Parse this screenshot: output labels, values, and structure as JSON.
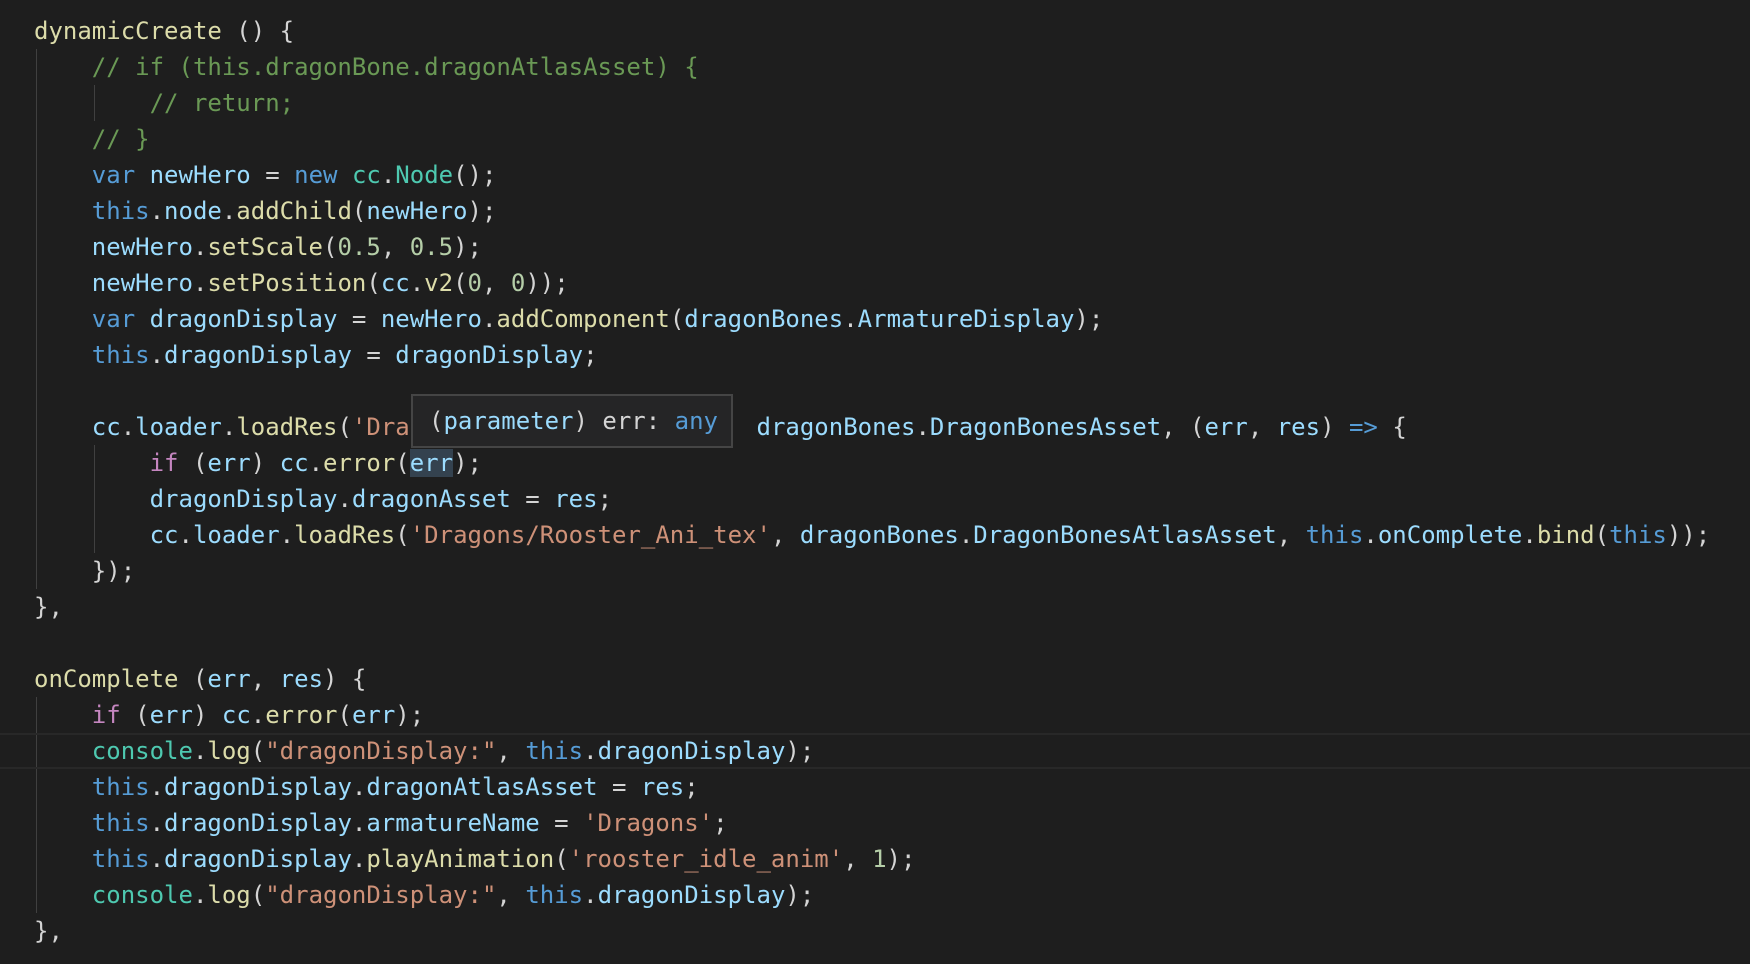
{
  "editor": {
    "language": "javascript",
    "lines": [
      [
        {
          "c": "fn",
          "t": "dynamicCreate"
        },
        {
          "c": "pl",
          "t": " () {"
        }
      ],
      [
        {
          "c": "cm",
          "t": "    // if (this.dragonBone.dragonAtlasAsset) {"
        }
      ],
      [
        {
          "c": "cm",
          "t": "        // return;"
        }
      ],
      [
        {
          "c": "cm",
          "t": "    // }"
        }
      ],
      [
        {
          "c": "pl",
          "t": "    "
        },
        {
          "c": "kw",
          "t": "var"
        },
        {
          "c": "pl",
          "t": " "
        },
        {
          "c": "var",
          "t": "newHero"
        },
        {
          "c": "pl",
          "t": " = "
        },
        {
          "c": "kw",
          "t": "new"
        },
        {
          "c": "pl",
          "t": " "
        },
        {
          "c": "cls",
          "t": "cc"
        },
        {
          "c": "pl",
          "t": "."
        },
        {
          "c": "cls",
          "t": "Node"
        },
        {
          "c": "pl",
          "t": "();"
        }
      ],
      [
        {
          "c": "pl",
          "t": "    "
        },
        {
          "c": "kw",
          "t": "this"
        },
        {
          "c": "pl",
          "t": "."
        },
        {
          "c": "var",
          "t": "node"
        },
        {
          "c": "pl",
          "t": "."
        },
        {
          "c": "fn",
          "t": "addChild"
        },
        {
          "c": "pl",
          "t": "("
        },
        {
          "c": "var",
          "t": "newHero"
        },
        {
          "c": "pl",
          "t": ");"
        }
      ],
      [
        {
          "c": "pl",
          "t": "    "
        },
        {
          "c": "var",
          "t": "newHero"
        },
        {
          "c": "pl",
          "t": "."
        },
        {
          "c": "fn",
          "t": "setScale"
        },
        {
          "c": "pl",
          "t": "("
        },
        {
          "c": "num",
          "t": "0.5"
        },
        {
          "c": "pl",
          "t": ", "
        },
        {
          "c": "num",
          "t": "0.5"
        },
        {
          "c": "pl",
          "t": ");"
        }
      ],
      [
        {
          "c": "pl",
          "t": "    "
        },
        {
          "c": "var",
          "t": "newHero"
        },
        {
          "c": "pl",
          "t": "."
        },
        {
          "c": "fn",
          "t": "setPosition"
        },
        {
          "c": "pl",
          "t": "("
        },
        {
          "c": "var",
          "t": "cc"
        },
        {
          "c": "pl",
          "t": "."
        },
        {
          "c": "fn",
          "t": "v2"
        },
        {
          "c": "pl",
          "t": "("
        },
        {
          "c": "num",
          "t": "0"
        },
        {
          "c": "pl",
          "t": ", "
        },
        {
          "c": "num",
          "t": "0"
        },
        {
          "c": "pl",
          "t": "));"
        }
      ],
      [
        {
          "c": "pl",
          "t": "    "
        },
        {
          "c": "kw",
          "t": "var"
        },
        {
          "c": "pl",
          "t": " "
        },
        {
          "c": "var",
          "t": "dragonDisplay"
        },
        {
          "c": "pl",
          "t": " = "
        },
        {
          "c": "var",
          "t": "newHero"
        },
        {
          "c": "pl",
          "t": "."
        },
        {
          "c": "fn",
          "t": "addComponent"
        },
        {
          "c": "pl",
          "t": "("
        },
        {
          "c": "var",
          "t": "dragonBones"
        },
        {
          "c": "pl",
          "t": "."
        },
        {
          "c": "var",
          "t": "ArmatureDisplay"
        },
        {
          "c": "pl",
          "t": ");"
        }
      ],
      [
        {
          "c": "pl",
          "t": "    "
        },
        {
          "c": "kw",
          "t": "this"
        },
        {
          "c": "pl",
          "t": "."
        },
        {
          "c": "var",
          "t": "dragonDisplay"
        },
        {
          "c": "pl",
          "t": " = "
        },
        {
          "c": "var",
          "t": "dragonDisplay"
        },
        {
          "c": "pl",
          "t": ";"
        }
      ],
      [],
      [
        {
          "c": "pl",
          "t": "    "
        },
        {
          "c": "var",
          "t": "cc"
        },
        {
          "c": "pl",
          "t": "."
        },
        {
          "c": "var",
          "t": "loader"
        },
        {
          "c": "pl",
          "t": "."
        },
        {
          "c": "fn",
          "t": "loadRes"
        },
        {
          "c": "pl",
          "t": "("
        },
        {
          "c": "str",
          "t": "'Dra"
        },
        {
          "c": "pl",
          "t": "                        "
        },
        {
          "c": "var",
          "t": "dragonBones"
        },
        {
          "c": "pl",
          "t": "."
        },
        {
          "c": "var",
          "t": "DragonBonesAsset"
        },
        {
          "c": "pl",
          "t": ", ("
        },
        {
          "c": "var",
          "t": "err"
        },
        {
          "c": "pl",
          "t": ", "
        },
        {
          "c": "var",
          "t": "res"
        },
        {
          "c": "pl",
          "t": ") "
        },
        {
          "c": "kw",
          "t": "=>"
        },
        {
          "c": "pl",
          "t": " {"
        }
      ],
      [
        {
          "c": "pl",
          "t": "        "
        },
        {
          "c": "ctl",
          "t": "if"
        },
        {
          "c": "pl",
          "t": " ("
        },
        {
          "c": "var",
          "t": "err"
        },
        {
          "c": "pl",
          "t": ") "
        },
        {
          "c": "var",
          "t": "cc"
        },
        {
          "c": "pl",
          "t": "."
        },
        {
          "c": "fn",
          "t": "error"
        },
        {
          "c": "pl",
          "t": "("
        },
        {
          "c": "var hl",
          "t": "err"
        },
        {
          "c": "pl",
          "t": ");"
        }
      ],
      [
        {
          "c": "pl",
          "t": "        "
        },
        {
          "c": "var",
          "t": "dragonDisplay"
        },
        {
          "c": "pl",
          "t": "."
        },
        {
          "c": "var",
          "t": "dragonAsset"
        },
        {
          "c": "pl",
          "t": " = "
        },
        {
          "c": "var",
          "t": "res"
        },
        {
          "c": "pl",
          "t": ";"
        }
      ],
      [
        {
          "c": "pl",
          "t": "        "
        },
        {
          "c": "var",
          "t": "cc"
        },
        {
          "c": "pl",
          "t": "."
        },
        {
          "c": "var",
          "t": "loader"
        },
        {
          "c": "pl",
          "t": "."
        },
        {
          "c": "fn",
          "t": "loadRes"
        },
        {
          "c": "pl",
          "t": "("
        },
        {
          "c": "str",
          "t": "'Dragons/Rooster_Ani_tex'"
        },
        {
          "c": "pl",
          "t": ", "
        },
        {
          "c": "var",
          "t": "dragonBones"
        },
        {
          "c": "pl",
          "t": "."
        },
        {
          "c": "var",
          "t": "DragonBonesAtlasAsset"
        },
        {
          "c": "pl",
          "t": ", "
        },
        {
          "c": "kw",
          "t": "this"
        },
        {
          "c": "pl",
          "t": "."
        },
        {
          "c": "var",
          "t": "onComplete"
        },
        {
          "c": "pl",
          "t": "."
        },
        {
          "c": "fn",
          "t": "bind"
        },
        {
          "c": "pl",
          "t": "("
        },
        {
          "c": "kw",
          "t": "this"
        },
        {
          "c": "pl",
          "t": "));"
        }
      ],
      [
        {
          "c": "pl",
          "t": "    });"
        }
      ],
      [
        {
          "c": "pl",
          "t": "},"
        }
      ],
      [],
      [
        {
          "c": "fn",
          "t": "onComplete"
        },
        {
          "c": "pl",
          "t": " ("
        },
        {
          "c": "var",
          "t": "err"
        },
        {
          "c": "pl",
          "t": ", "
        },
        {
          "c": "var",
          "t": "res"
        },
        {
          "c": "pl",
          "t": ") {"
        }
      ],
      [
        {
          "c": "pl",
          "t": "    "
        },
        {
          "c": "ctl",
          "t": "if"
        },
        {
          "c": "pl",
          "t": " ("
        },
        {
          "c": "var",
          "t": "err"
        },
        {
          "c": "pl",
          "t": ") "
        },
        {
          "c": "var",
          "t": "cc"
        },
        {
          "c": "pl",
          "t": "."
        },
        {
          "c": "fn",
          "t": "error"
        },
        {
          "c": "pl",
          "t": "("
        },
        {
          "c": "var",
          "t": "err"
        },
        {
          "c": "pl",
          "t": ");"
        }
      ],
      [
        {
          "c": "pl",
          "t": "    "
        },
        {
          "c": "cls",
          "t": "console"
        },
        {
          "c": "pl",
          "t": "."
        },
        {
          "c": "fn",
          "t": "log"
        },
        {
          "c": "pl",
          "t": "("
        },
        {
          "c": "str",
          "t": "\"dragonDisplay:\""
        },
        {
          "c": "pl",
          "t": ", "
        },
        {
          "c": "kw",
          "t": "this"
        },
        {
          "c": "pl",
          "t": "."
        },
        {
          "c": "var",
          "t": "dragonDisplay"
        },
        {
          "c": "pl",
          "t": ");"
        }
      ],
      [
        {
          "c": "pl",
          "t": "    "
        },
        {
          "c": "kw",
          "t": "this"
        },
        {
          "c": "pl",
          "t": "."
        },
        {
          "c": "var",
          "t": "dragonDisplay"
        },
        {
          "c": "pl",
          "t": "."
        },
        {
          "c": "var",
          "t": "dragonAtlasAsset"
        },
        {
          "c": "pl",
          "t": " = "
        },
        {
          "c": "var",
          "t": "res"
        },
        {
          "c": "pl",
          "t": ";"
        }
      ],
      [
        {
          "c": "pl",
          "t": "    "
        },
        {
          "c": "kw",
          "t": "this"
        },
        {
          "c": "pl",
          "t": "."
        },
        {
          "c": "var",
          "t": "dragonDisplay"
        },
        {
          "c": "pl",
          "t": "."
        },
        {
          "c": "var",
          "t": "armatureName"
        },
        {
          "c": "pl",
          "t": " = "
        },
        {
          "c": "str",
          "t": "'Dragons'"
        },
        {
          "c": "pl",
          "t": ";"
        }
      ],
      [
        {
          "c": "pl",
          "t": "    "
        },
        {
          "c": "kw",
          "t": "this"
        },
        {
          "c": "pl",
          "t": "."
        },
        {
          "c": "var",
          "t": "dragonDisplay"
        },
        {
          "c": "pl",
          "t": "."
        },
        {
          "c": "fn",
          "t": "playAnimation"
        },
        {
          "c": "pl",
          "t": "("
        },
        {
          "c": "str",
          "t": "'rooster_idle_anim'"
        },
        {
          "c": "pl",
          "t": ", "
        },
        {
          "c": "num",
          "t": "1"
        },
        {
          "c": "pl",
          "t": ");"
        }
      ],
      [
        {
          "c": "pl",
          "t": "    "
        },
        {
          "c": "cls",
          "t": "console"
        },
        {
          "c": "pl",
          "t": "."
        },
        {
          "c": "fn",
          "t": "log"
        },
        {
          "c": "pl",
          "t": "("
        },
        {
          "c": "str",
          "t": "\"dragonDisplay:\""
        },
        {
          "c": "pl",
          "t": ", "
        },
        {
          "c": "kw",
          "t": "this"
        },
        {
          "c": "pl",
          "t": "."
        },
        {
          "c": "var",
          "t": "dragonDisplay"
        },
        {
          "c": "pl",
          "t": ");"
        }
      ],
      [
        {
          "c": "pl",
          "t": "},"
        }
      ]
    ]
  },
  "hover_tooltip": {
    "open_paren": "(",
    "kind": "parameter",
    "close_paren": ")",
    "signature": " err: ",
    "type": "any"
  },
  "colors": {
    "background": "#1e1e1e",
    "function": "#dcdcaa",
    "keyword": "#569cd6",
    "control": "#c586c0",
    "variable": "#9cdcfe",
    "class": "#4ec9b0",
    "string": "#ce9178",
    "number": "#b5cea8",
    "comment": "#6a9955"
  }
}
